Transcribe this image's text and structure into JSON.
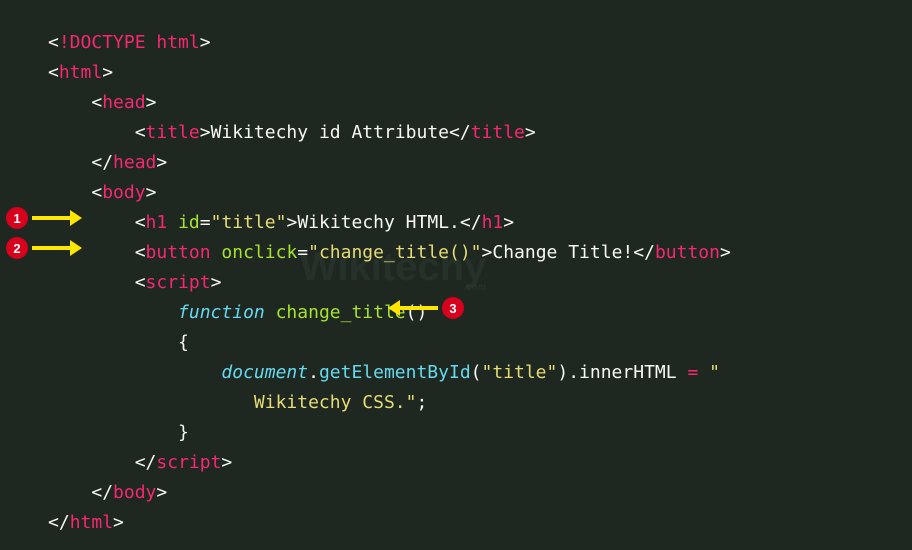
{
  "code": {
    "doctype": "!DOCTYPE html",
    "html": "html",
    "head": "head",
    "title_tag": "title",
    "title_text": "Wikitechy id Attribute",
    "body": "body",
    "h1_tag": "h1",
    "h1_attr": "id",
    "h1_attr_val": "\"title\"",
    "h1_text": "Wikitechy HTML.",
    "button_tag": "button",
    "button_attr": "onclick",
    "button_attr_val": "\"change_title()\"",
    "button_text": "Change Title!",
    "script_tag": "script",
    "fn_keyword": "function",
    "fn_name": "change_title",
    "fn_parens": "()",
    "brace_open": "{",
    "doc_var": "document",
    "method_name": "getElementById",
    "method_arg": "\"title\"",
    "prop": "innerHTML",
    "assign_val1": "\"",
    "assign_val2": "Wikitechy CSS.\"",
    "brace_close": "}",
    "indent1": "    ",
    "indent2": "        ",
    "indent3": "            ",
    "indent4": "                "
  },
  "markers": {
    "m1": "1",
    "m2": "2",
    "m3": "3"
  },
  "watermark": "Wikitechy"
}
